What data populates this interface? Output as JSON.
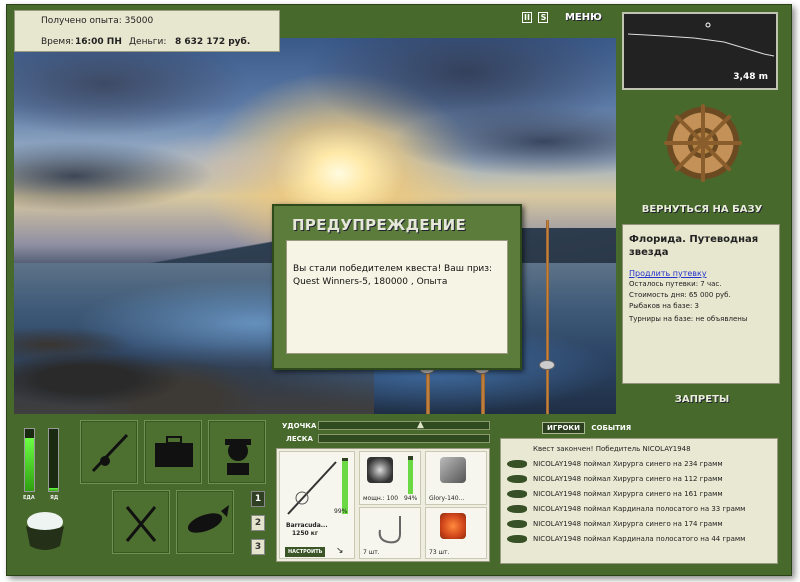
{
  "hud": {
    "experience": "Получено опыта: 35000",
    "time_label": "Время:",
    "time_value": "16:00 ПН",
    "money_label": "Деньги:",
    "money_value": "8 632 172 руб.",
    "pause": "II",
    "sound": "S",
    "menu": "МЕНЮ"
  },
  "depth": {
    "value": "3,48 m"
  },
  "right_panel": {
    "back_to_base": "ВЕРНУТЬСЯ НА БАЗУ",
    "place_title": "Флорида. Путеводная звезда",
    "extend_trip": "Продлить путевку",
    "lines": [
      "Осталось путевки: 7 час.",
      "Стоимость дня: 65 000 руб.",
      "Рыбаков на базе: 3",
      "Турниры на базе: не объявлены"
    ],
    "bans": "ЗАПРЕТЫ"
  },
  "modal": {
    "title": "ПРЕДУПРЕЖДЕНИЕ",
    "message": "Вы стали победителем квеста! Ваш приз: Quest Winners-5, 180000 , Опыта"
  },
  "bars": {
    "food_label": "ЕДА",
    "poison_label": "ЯД",
    "food_level": 0.85,
    "poison_level": 0.05
  },
  "pages": [
    "1",
    "2",
    "3"
  ],
  "rod_controls": {
    "rod_label": "УДОЧКА",
    "line_label": "ЛЕСКА"
  },
  "inventory": {
    "rod_name": "Barracuda...",
    "rod_weight": "1250 кг",
    "rod_percent": "99%",
    "setup_button": "НАСТРОИТЬ",
    "reel_caption": "мощн.: 100",
    "reel_percent": "94%",
    "lure_caption": "Glory-140...",
    "hook_caption": "7 шт.",
    "bait_caption": "73 шт."
  },
  "events": {
    "tabs": [
      "ИГРОКИ",
      "СОБЫТИЯ"
    ],
    "header": "Квест закончен! Победитель NICOLAY1948",
    "items": [
      "NICOLAY1948 поймал Хирурга синего на 234 грамм",
      "NICOLAY1948 поймал Хирурга синего на 112 грамм",
      "NICOLAY1948 поймал Хирурга синего на 161 грамм",
      "NICOLAY1948 поймал Кардинала полосатого на 33 грамм",
      "NICOLAY1948 поймал Хирурга синего на 174 грамм",
      "NICOLAY1948 поймал Кардинала полосатого на 44 грамм"
    ]
  }
}
